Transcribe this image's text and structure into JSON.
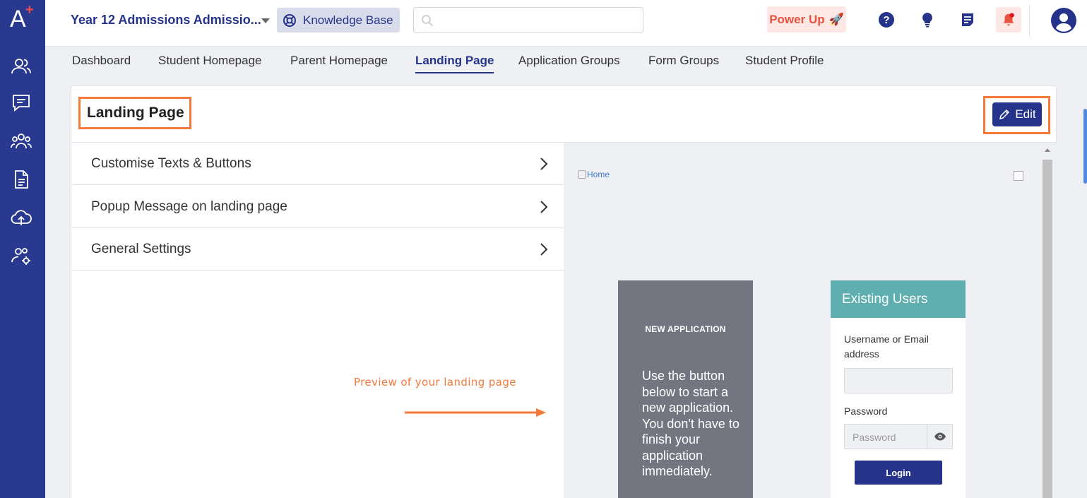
{
  "header": {
    "school_name": "Year 12 Admissions Admissio...",
    "knowledge_base_label": "Knowledge Base",
    "search_placeholder": "",
    "power_up_label": "Power Up",
    "power_up_emoji": "🚀"
  },
  "tabs": [
    {
      "label": "Dashboard",
      "active": false
    },
    {
      "label": "Student Homepage",
      "active": false
    },
    {
      "label": "Parent Homepage",
      "active": false
    },
    {
      "label": "Landing Page",
      "active": true
    },
    {
      "label": "Application Groups",
      "active": false
    },
    {
      "label": "Form Groups",
      "active": false
    },
    {
      "label": "Student Profile",
      "active": false
    }
  ],
  "panel": {
    "title": "Landing Page",
    "edit_label": "Edit"
  },
  "sections": [
    {
      "label": "Customise Texts & Buttons"
    },
    {
      "label": "Popup Message on landing page"
    },
    {
      "label": "General Settings"
    }
  ],
  "annotation": {
    "text": "Preview of your landing page"
  },
  "preview": {
    "home_alt": "Home",
    "new_application": {
      "heading": "NEW APPLICATION",
      "body": "Use the button below to start a new application. You don't have to finish your application immediately."
    },
    "existing_users": {
      "heading": "Existing Users",
      "username_label": "Username or Email address",
      "username_value": "",
      "password_label": "Password",
      "password_placeholder": "Password",
      "login_label": "Login"
    }
  },
  "colors": {
    "sidebar": "#2a3990",
    "accent": "#25348a",
    "highlight": "#f47a3c",
    "power_up_bg": "#fde8e6",
    "power_up_text": "#e8533f",
    "existing_header": "#5faeb0",
    "new_app_bg": "#737680"
  },
  "icons": {
    "sidebar": [
      "users-icon",
      "chat-icon",
      "group-icon",
      "document-icon",
      "cloud-upload-icon",
      "users-settings-icon"
    ],
    "topbar": [
      "search-icon",
      "help-icon",
      "lightbulb-icon",
      "notes-icon",
      "bell-icon",
      "avatar-icon"
    ]
  }
}
